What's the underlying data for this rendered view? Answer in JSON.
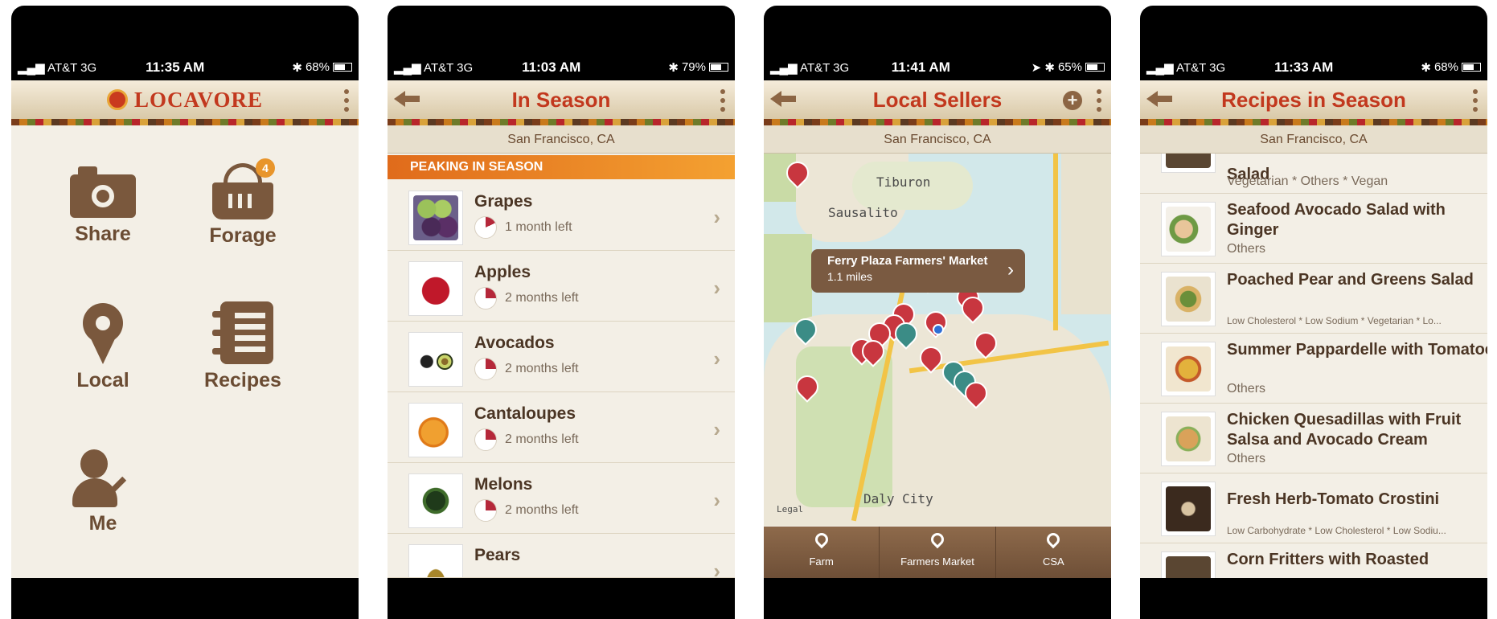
{
  "status": {
    "carrier": "AT&T",
    "network": "3G",
    "phones": [
      {
        "time": "11:35 AM",
        "battery": "68%"
      },
      {
        "time": "11:03 AM",
        "battery": "79%"
      },
      {
        "time": "11:41 AM",
        "battery": "65%"
      },
      {
        "time": "11:33 AM",
        "battery": "68%"
      }
    ]
  },
  "home": {
    "logo_text": "LOCAVORE",
    "tiles": [
      "Share",
      "Forage",
      "Local",
      "Recipes",
      "Me"
    ],
    "forage_badge": "4"
  },
  "in_season": {
    "title": "In Season",
    "location": "San Francisco, CA",
    "section": "PEAKING IN SEASON",
    "items": [
      {
        "name": "Grapes",
        "left": "1 month left"
      },
      {
        "name": "Apples",
        "left": "2 months left"
      },
      {
        "name": "Avocados",
        "left": "2 months left"
      },
      {
        "name": "Cantaloupes",
        "left": "2 months left"
      },
      {
        "name": "Melons",
        "left": "2 months left"
      },
      {
        "name": "Pears",
        "left": ""
      }
    ]
  },
  "sellers": {
    "title": "Local Sellers",
    "location": "San Francisco, CA",
    "callout_title": "Ferry Plaza Farmers' Market",
    "callout_dist": "1.1 miles",
    "map_labels": [
      "Tiburon",
      "Sausalito",
      "Daly City",
      "Legal"
    ],
    "tabs": [
      "Farm",
      "Farmers Market",
      "CSA"
    ]
  },
  "recipes": {
    "title": "Recipes in Season",
    "location": "San Francisco, CA",
    "items": [
      {
        "name": "Salad",
        "tags": "Vegetarian * Others * Vegan"
      },
      {
        "name": "Seafood Avocado Salad with Ginger",
        "tags": "Others"
      },
      {
        "name": "Poached Pear and Greens Salad",
        "tags": "Low Cholesterol * Low Sodium * Vegetarian * Lo..."
      },
      {
        "name": "Summer Pappardelle with Tomatoes, Arugula, and Par...",
        "tags": "Others"
      },
      {
        "name": "Chicken Quesadillas with Fruit Salsa and Avocado Cream",
        "tags": "Others"
      },
      {
        "name": "Fresh Herb-Tomato Crostini",
        "tags": "Low Carbohydrate * Low Cholesterol * Low Sodiu..."
      },
      {
        "name": "Corn Fritters with Roasted",
        "tags": ""
      }
    ]
  }
}
